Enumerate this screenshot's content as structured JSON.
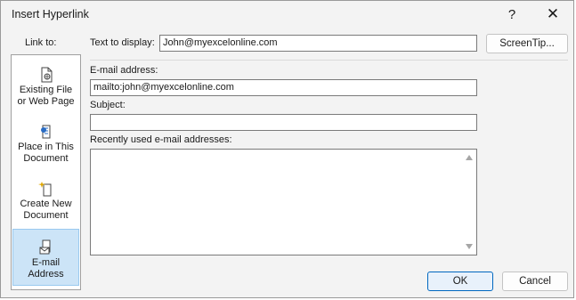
{
  "window": {
    "title": "Insert Hyperlink",
    "help_glyph": "?",
    "close_glyph": "✕"
  },
  "link_to": {
    "label": "Link to:",
    "items": [
      {
        "line1": "Existing File",
        "line2": "or Web Page",
        "icon": "existing-file-icon"
      },
      {
        "line1": "Place in This",
        "line2": "Document",
        "icon": "place-in-document-icon"
      },
      {
        "line1": "Create New",
        "line2": "Document",
        "icon": "create-new-document-icon"
      },
      {
        "line1": "E-mail",
        "line2": "Address",
        "icon": "email-address-icon",
        "selected": true
      }
    ]
  },
  "text_to_display": {
    "label": "Text to display:",
    "value": "John@myexcelonline.com"
  },
  "screentip_label": "ScreenTip...",
  "email_address": {
    "label": "E-mail address:",
    "value": "mailto:john@myexcelonline.com"
  },
  "subject": {
    "label": "Subject:",
    "value": ""
  },
  "recent": {
    "label": "Recently used e-mail addresses:",
    "items": []
  },
  "buttons": {
    "ok": "OK",
    "cancel": "Cancel"
  },
  "colors": {
    "selected_bg": "#cce4f7",
    "accent": "#0067c0"
  }
}
